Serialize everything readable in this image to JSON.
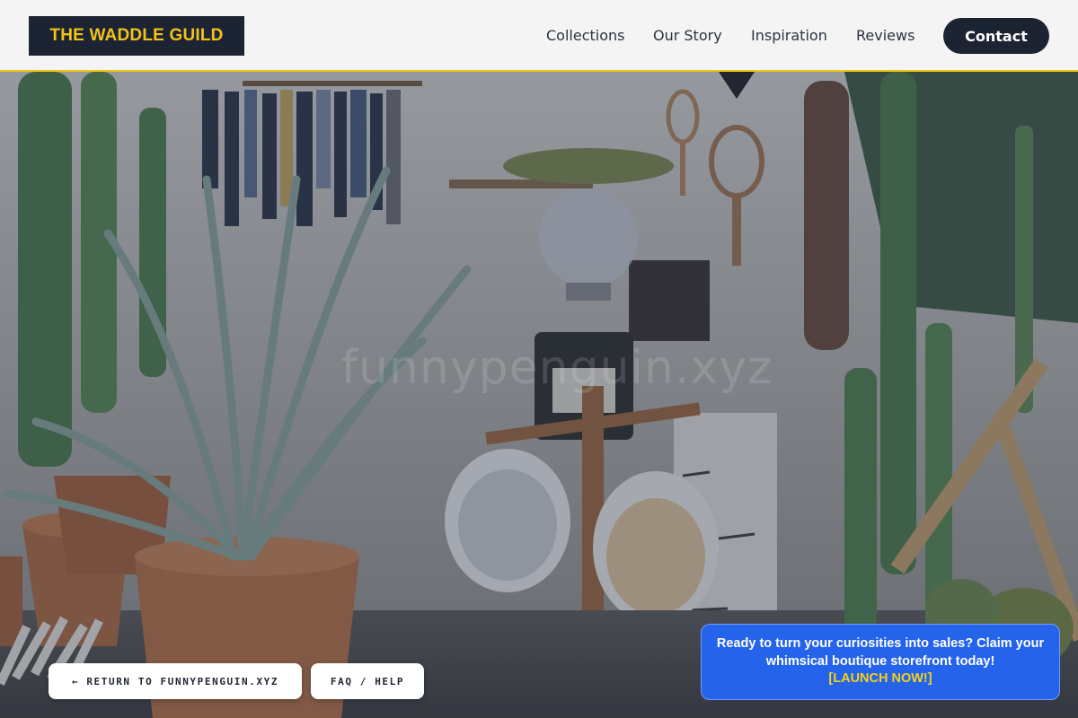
{
  "header": {
    "logo": "THE WADDLE GUILD",
    "nav": [
      "Collections",
      "Our Story",
      "Inspiration",
      "Reviews"
    ],
    "contact_label": "Contact"
  },
  "hero": {
    "watermark": "funnypenguin.xyz"
  },
  "footer_buttons": {
    "return_label": "← RETURN TO FUNNYPENGUIN.XYZ",
    "faq_label": "FAQ / HELP"
  },
  "promo": {
    "text": "Ready to turn your curiosities into sales? Claim your whimsical boutique storefront today!",
    "cta": "[LAUNCH NOW!]"
  },
  "colors": {
    "accent": "#f2c21a",
    "dark": "#1c2333",
    "promo_blue": "#2563eb"
  }
}
